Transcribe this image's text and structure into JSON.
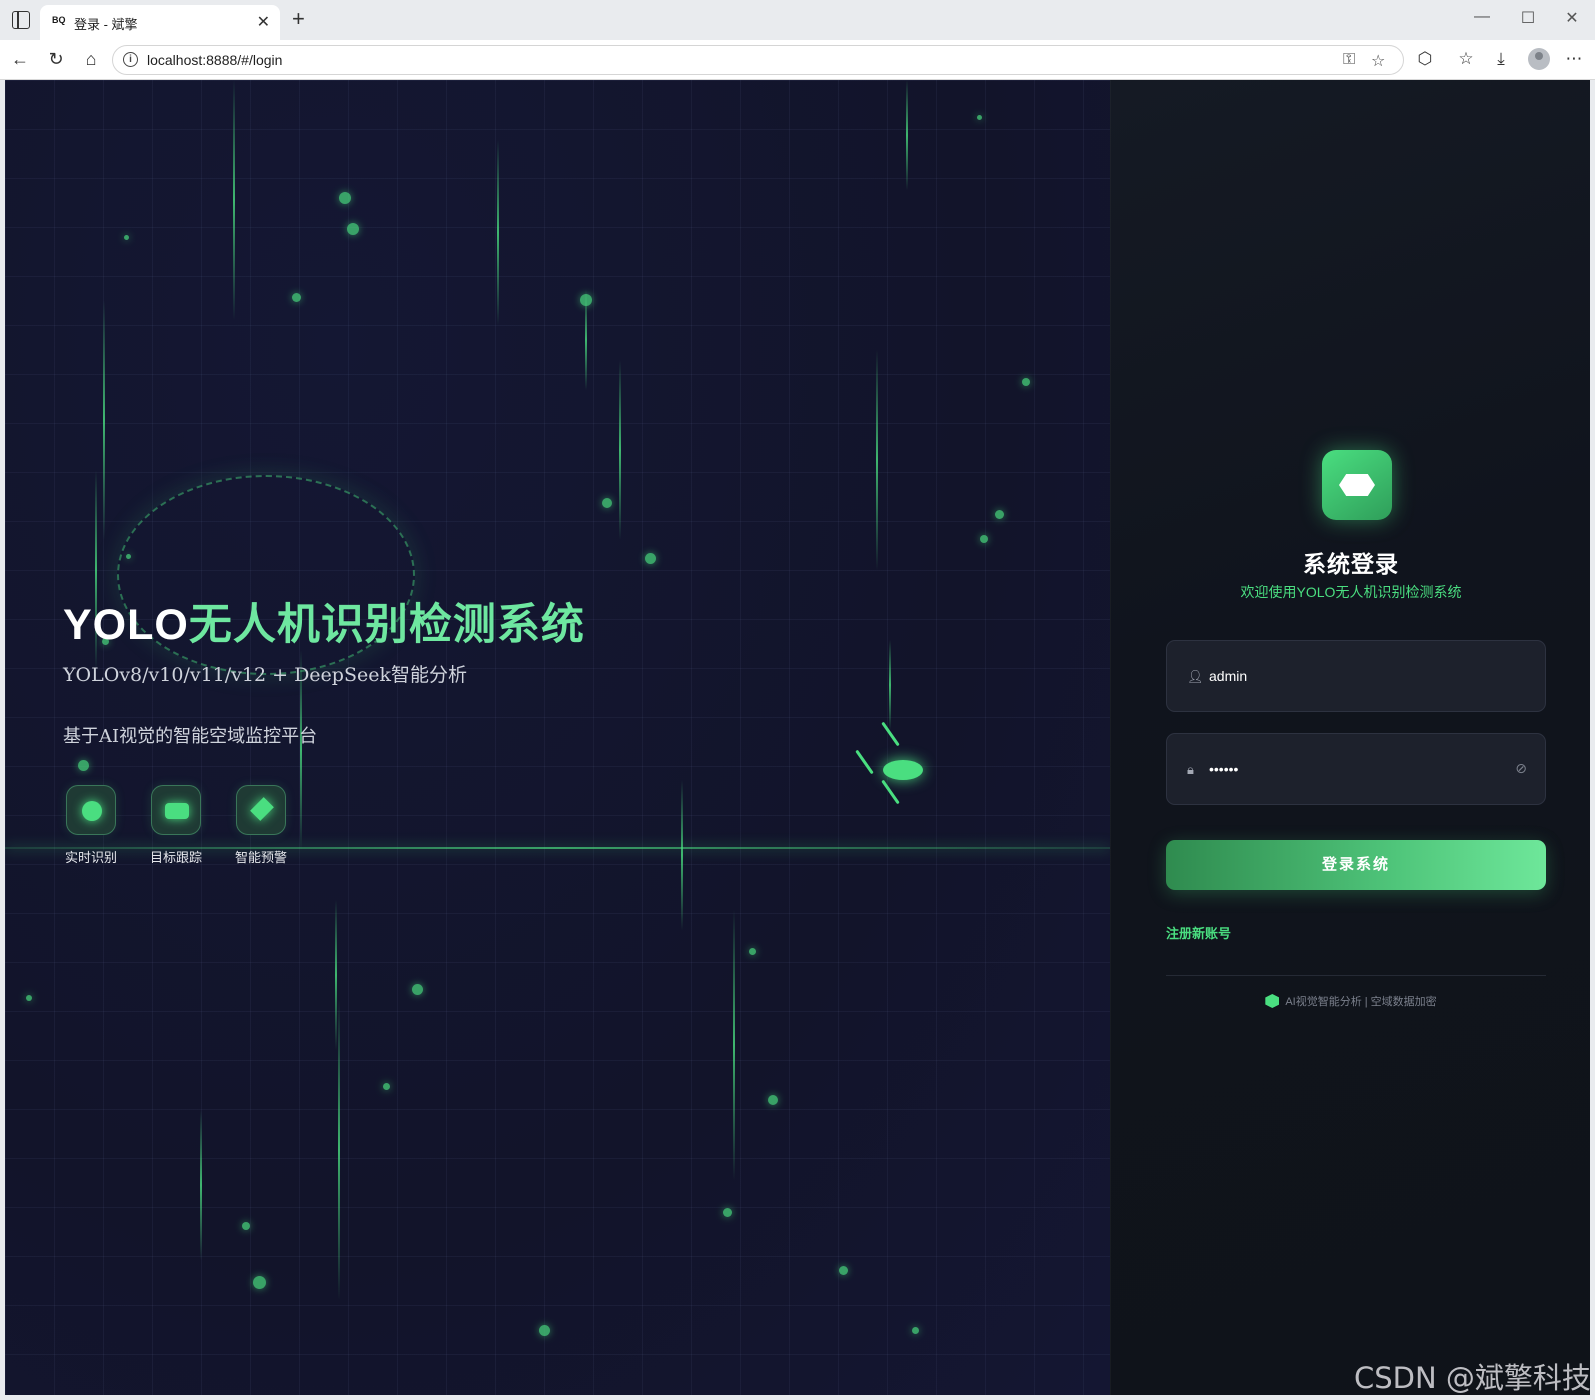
{
  "browser": {
    "tab_title": "登录 - 斌擎",
    "tab_favicon_text": "BQ",
    "url": "localhost:8888/#/login"
  },
  "hero": {
    "title_prefix": "YOLO",
    "title_main": "无人机识别检测系统",
    "subtitle": "YOLOv8/v10/v11/v12 + DeepSeek智能分析",
    "description": "基于AI视觉的智能空域监控平台",
    "features": [
      {
        "label": "实时识别",
        "icon": "circle-icon"
      },
      {
        "label": "目标跟踪",
        "icon": "rectangle-icon"
      },
      {
        "label": "智能预警",
        "icon": "diamond-icon"
      }
    ]
  },
  "login": {
    "title": "系统登录",
    "subtitle": "欢迎使用YOLO无人机识别检测系统",
    "username_value": "admin",
    "password_value": "••••••",
    "submit_label": "登录系统",
    "register_label": "注册新账号",
    "footer_note": "AI视觉智能分析 | 空域数据加密"
  },
  "watermark": "CSDN @斌擎科技",
  "colors": {
    "accent": "#4ade80",
    "background": "#12142a",
    "panel": "#10141d"
  }
}
